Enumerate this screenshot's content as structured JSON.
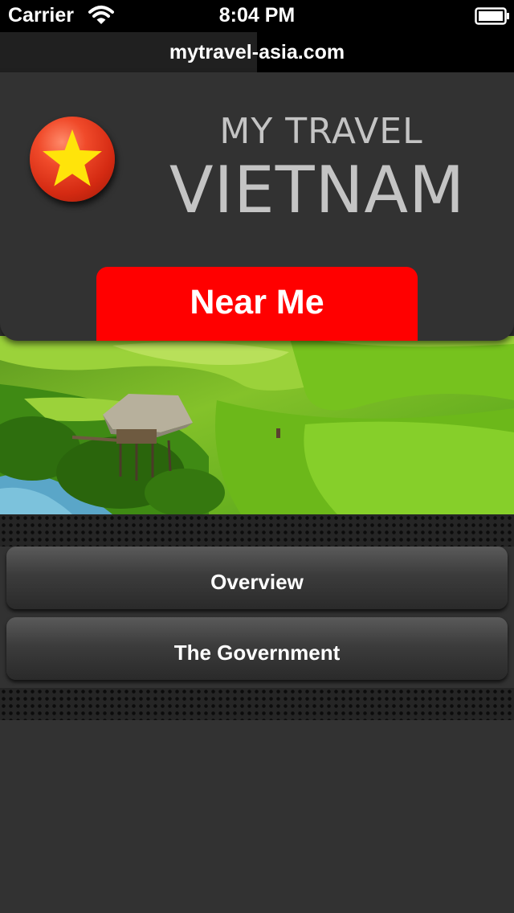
{
  "status_bar": {
    "carrier": "Carrier",
    "time": "8:04 PM",
    "wifi_icon": "wifi-icon",
    "battery_icon": "battery-icon"
  },
  "url_bar": {
    "url": "mytravel-asia.com"
  },
  "header": {
    "title_line1": "MY TRAVEL",
    "title_line2": "VIETNAM",
    "flag_icon": "vietnam-flag-icon",
    "near_me_label": "Near Me"
  },
  "hero_image": {
    "subject": "rice terraces with stilt hut"
  },
  "menu": {
    "items": [
      {
        "label": "Overview"
      },
      {
        "label": "The Government"
      }
    ]
  },
  "colors": {
    "accent_red": "#ff0000",
    "panel_bg": "#323232",
    "title_text": "#c4c4c4"
  }
}
